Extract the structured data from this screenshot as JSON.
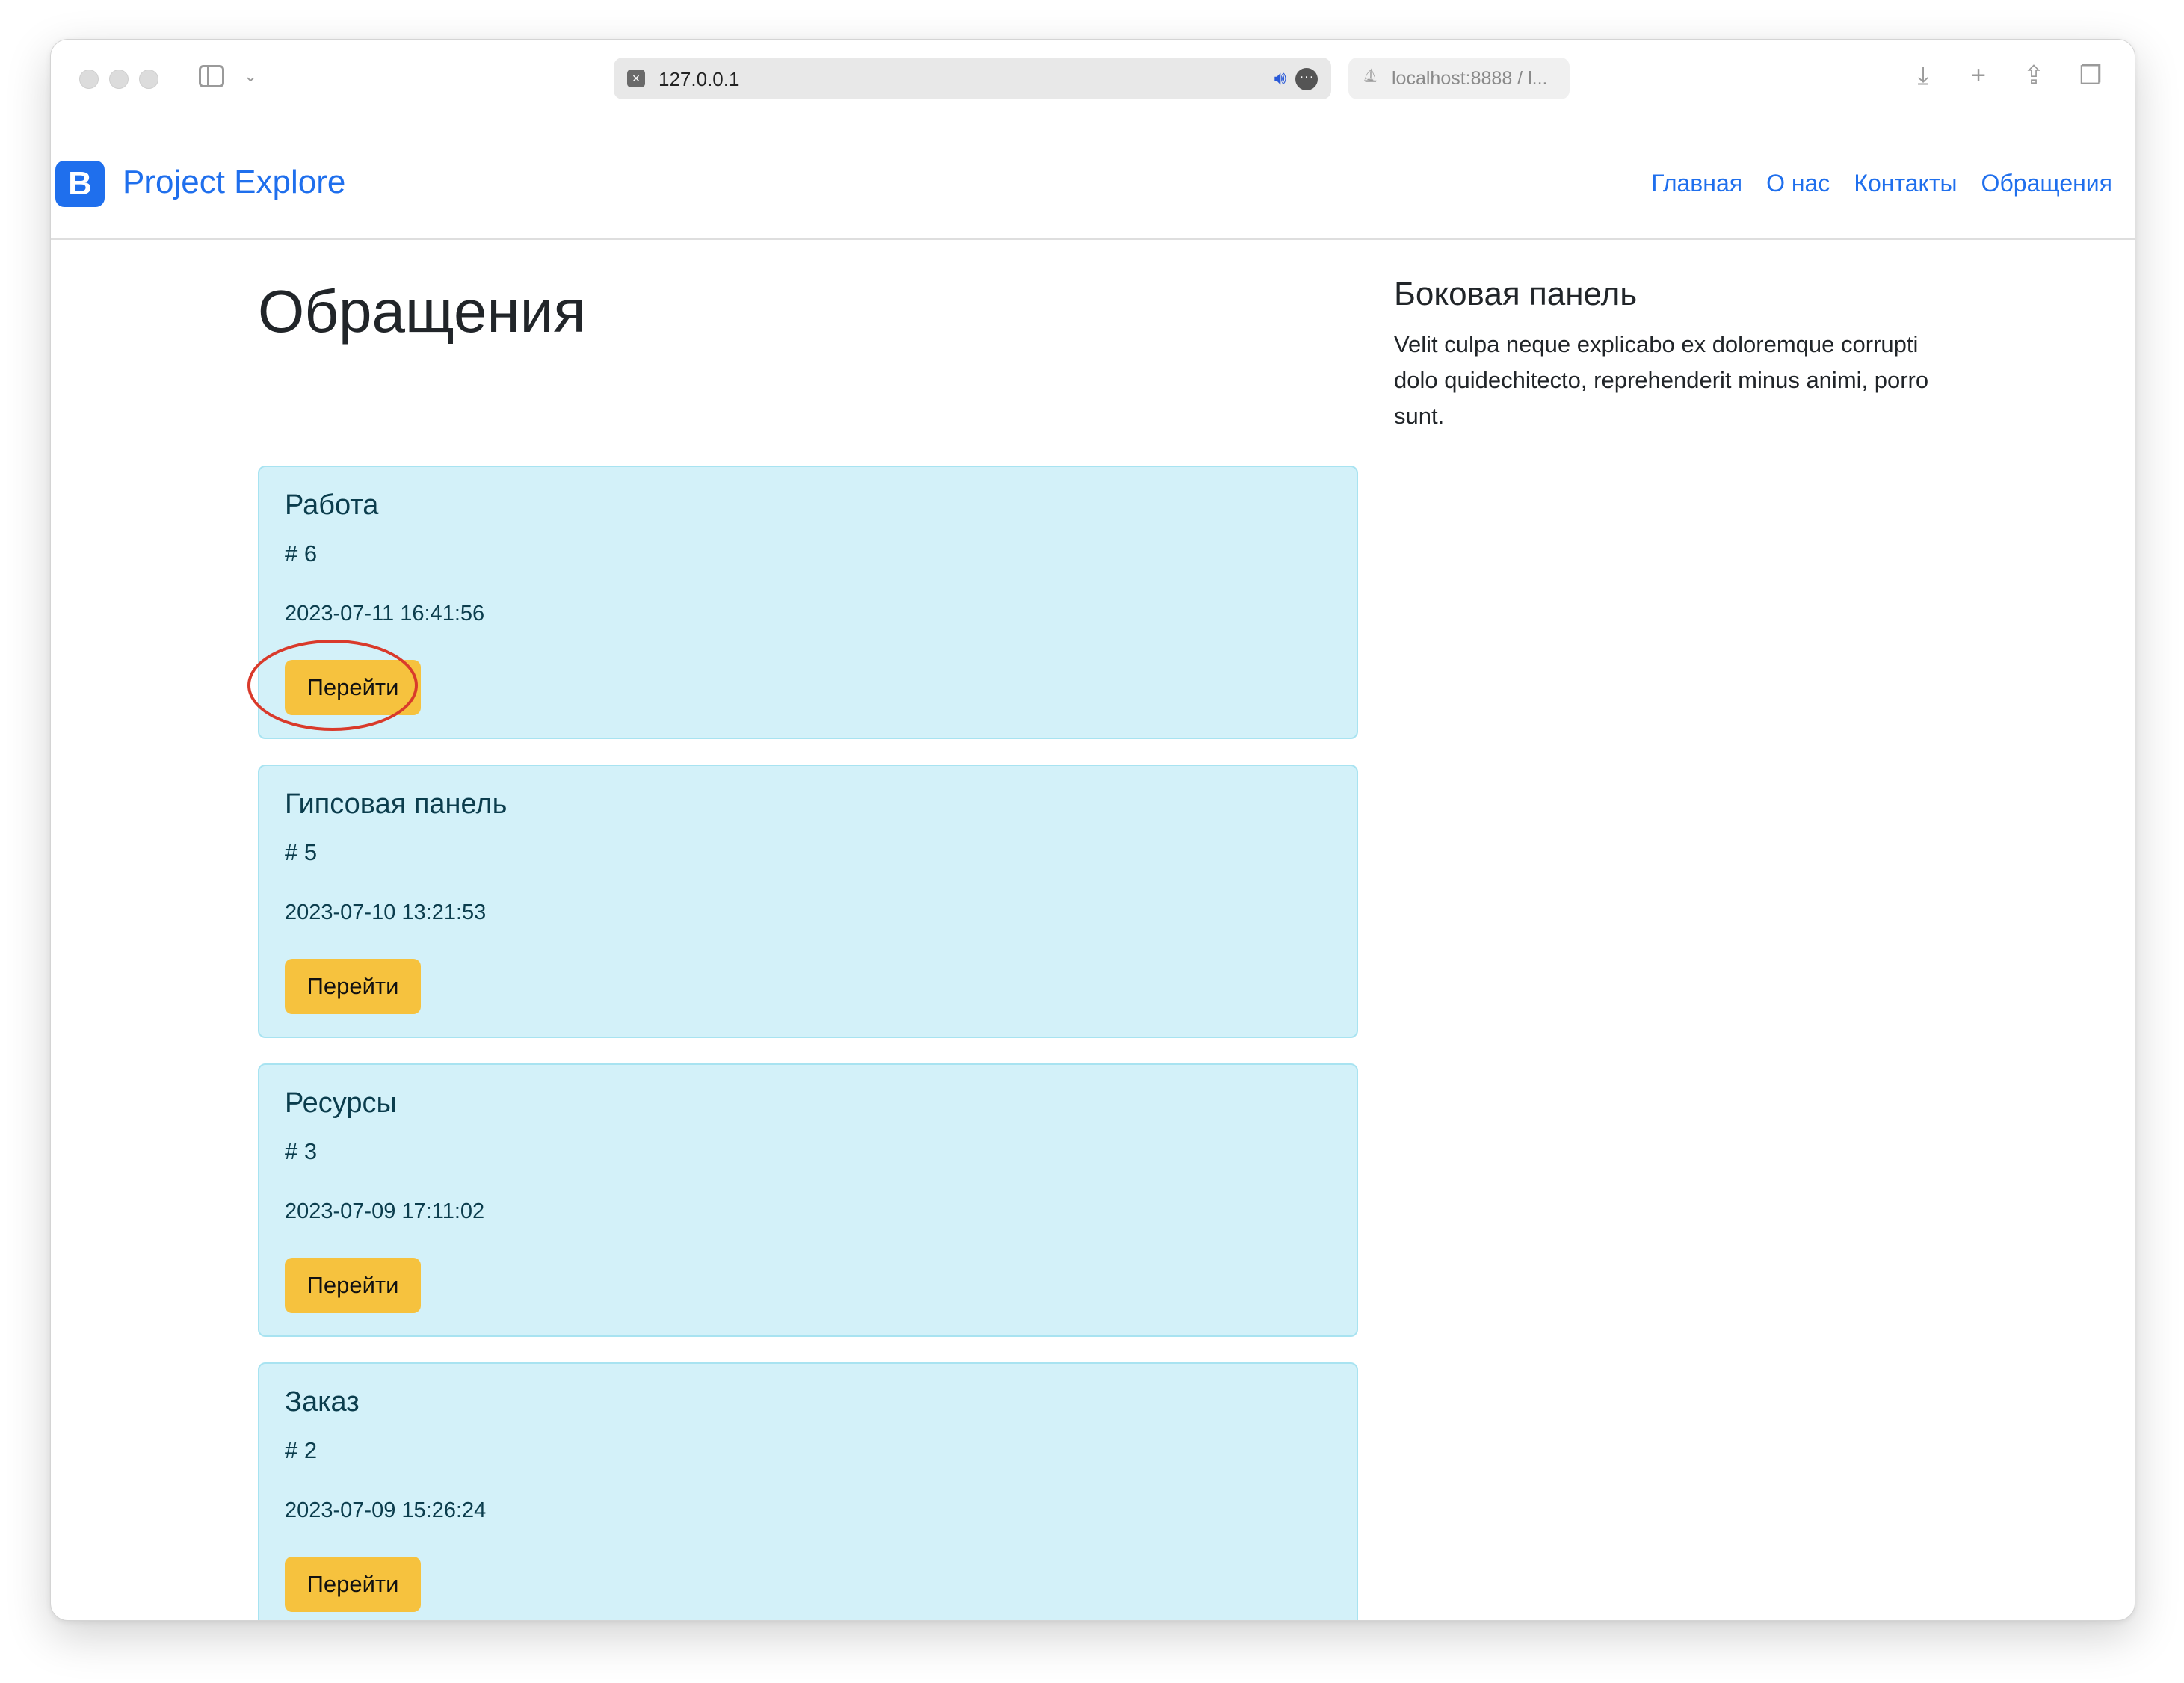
{
  "browser": {
    "url": "127.0.0.1",
    "second_tab": "localhost:8888 / l..."
  },
  "navbar": {
    "brand_letter": "B",
    "brand": "Project Explore",
    "links": [
      "Главная",
      "О нас",
      "Контакты",
      "Обращения"
    ]
  },
  "main": {
    "title": "Обращения",
    "cards": [
      {
        "title": "Работа",
        "number": "# 6",
        "date": "2023-07-11 16:41:56",
        "button": "Перейти"
      },
      {
        "title": "Гипсовая панель",
        "number": "# 5",
        "date": "2023-07-10 13:21:53",
        "button": "Перейти"
      },
      {
        "title": "Ресурсы",
        "number": "# 3",
        "date": "2023-07-09 17:11:02",
        "button": "Перейти"
      },
      {
        "title": "Заказ",
        "number": "# 2",
        "date": "2023-07-09 15:26:24",
        "button": "Перейти"
      }
    ]
  },
  "sidebar": {
    "title": "Боковая панель",
    "text": "Velit culpa neque explicabo ex doloremque corrupti dolo quidechitecto, reprehenderit minus animi, porro sunt."
  },
  "colors": {
    "brand": "#1f6fed",
    "card_bg": "#d3f1f9",
    "button": "#f6c23e",
    "highlight": "#d93a2b"
  }
}
